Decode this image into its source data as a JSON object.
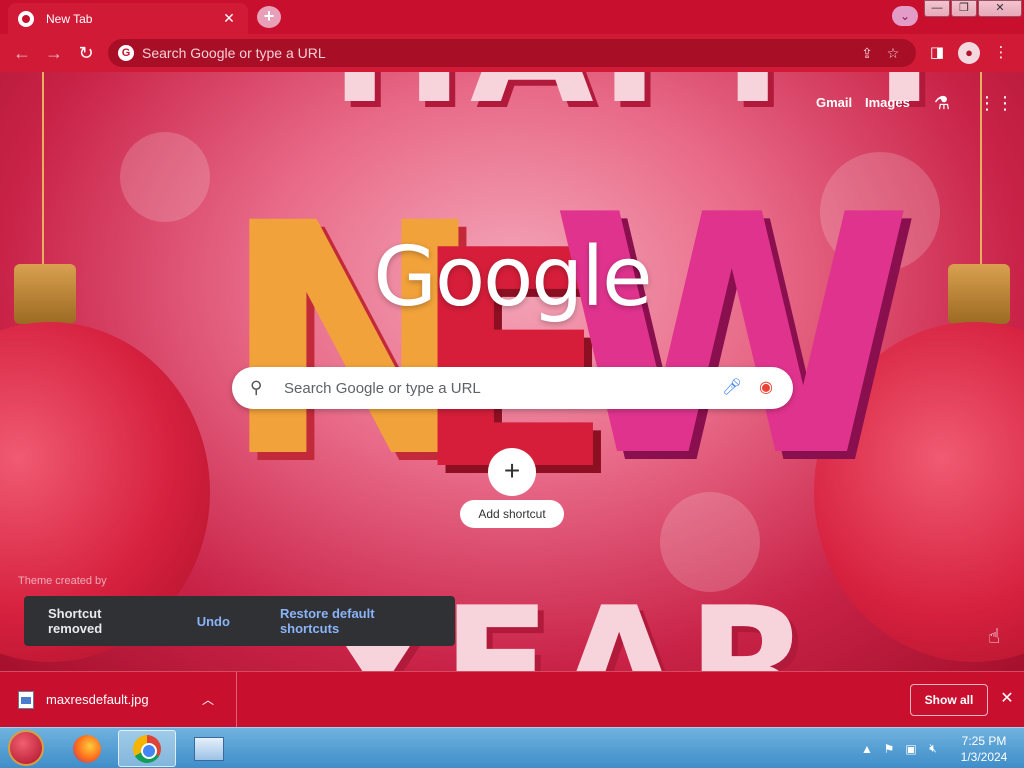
{
  "browser": {
    "tab_title": "New Tab",
    "tab_close": "✕",
    "new_tab": "+",
    "omnibox_placeholder": "Search Google or type a URL"
  },
  "window_buttons": {
    "minimize": "—",
    "restore": "❐",
    "close": "✕"
  },
  "ntp": {
    "gmail": "Gmail",
    "images": "Images",
    "logo_text": "Google",
    "search_placeholder": "Search Google or type a URL",
    "add_shortcut": "Add shortcut",
    "add_shortcut_plus": "+",
    "theme_credit": "Theme created by"
  },
  "snackbar": {
    "message": "Shortcut removed",
    "undo": "Undo",
    "restore": "Restore default shortcuts"
  },
  "downloads": {
    "file_name": "maxresdefault.jpg",
    "show_all": "Show all"
  },
  "taskbar": {
    "time": "7:25 PM",
    "date": "1/3/2024"
  },
  "icons": {
    "back": "back-arrow-icon",
    "forward": "forward-arrow-icon",
    "reload": "reload-icon",
    "share": "share-icon",
    "bookmark": "star-icon",
    "side_panel": "side-panel-icon",
    "profile": "profile-icon",
    "menu": "kebab-menu-icon",
    "labs": "flask-icon",
    "apps": "grid-apps-icon",
    "search": "search-icon",
    "voice": "microphone-icon",
    "lens": "camera-lens-icon"
  },
  "colors": {
    "chrome_red": "#c8102e",
    "snackbar_bg": "#303134",
    "link_blue": "#8ab4f8"
  }
}
